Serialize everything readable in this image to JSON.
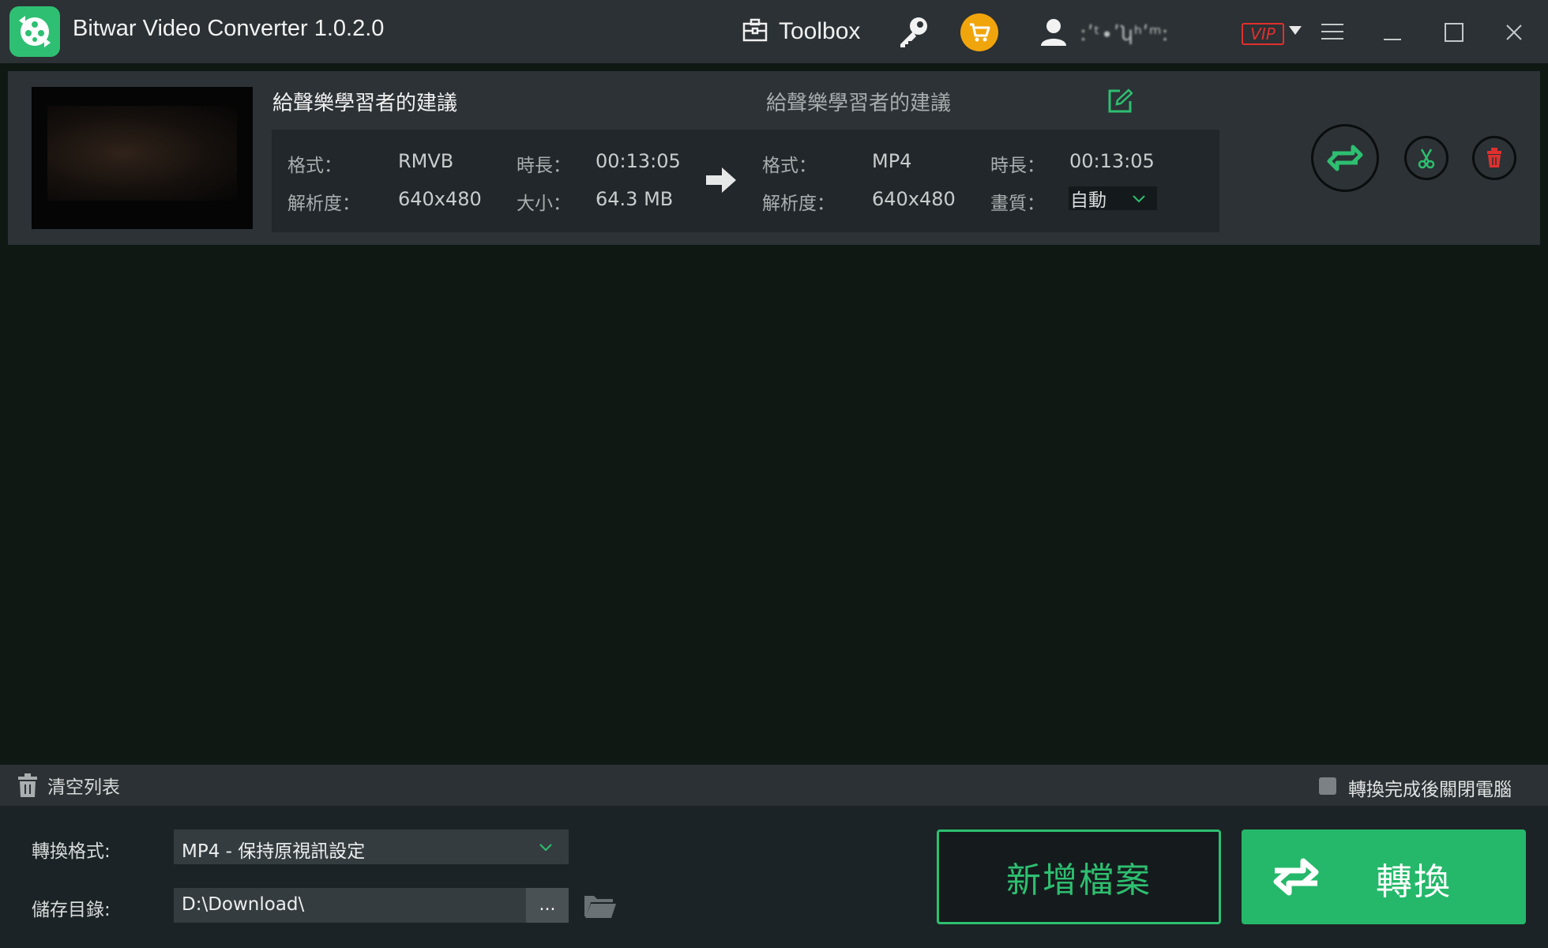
{
  "app": {
    "title": "Bitwar Video Converter  1.0.2.0",
    "toolbox_label": "Toolbox",
    "username": "ːʹᵗ∙ʹʮʰʹᵐː",
    "vip_label": "VIP"
  },
  "file": {
    "source_name": "給聲樂學習者的建議",
    "output_name": "給聲樂學習者的建議",
    "source": {
      "format_label": "格式：",
      "format": "RMVB",
      "duration_label": "時長：",
      "duration": "00:13:05",
      "resolution_label": "解析度：",
      "resolution": "640x480",
      "size_label": "大小：",
      "size": "64.3 MB"
    },
    "output": {
      "format_label": "格式：",
      "format": "MP4",
      "duration_label": "時長：",
      "duration": "00:13:05",
      "resolution_label": "解析度：",
      "resolution": "640x480",
      "quality_label": "畫質：",
      "quality": "自動"
    }
  },
  "list_bar": {
    "clear_label": "清空列表",
    "shutdown_label": "轉換完成後關閉電腦"
  },
  "settings": {
    "format_label": "轉換格式:",
    "format_value": "MP4 - 保持原視訊設定",
    "dir_label": "儲存目錄:",
    "dir_value": "D:\\Download\\",
    "browse_label": "..."
  },
  "actions": {
    "add_file_label": "新增檔案",
    "convert_label": "轉換"
  },
  "colors": {
    "accent": "#25b86a",
    "cart": "#f1a50c",
    "vip": "#e0302e",
    "delete": "#e0302e"
  }
}
